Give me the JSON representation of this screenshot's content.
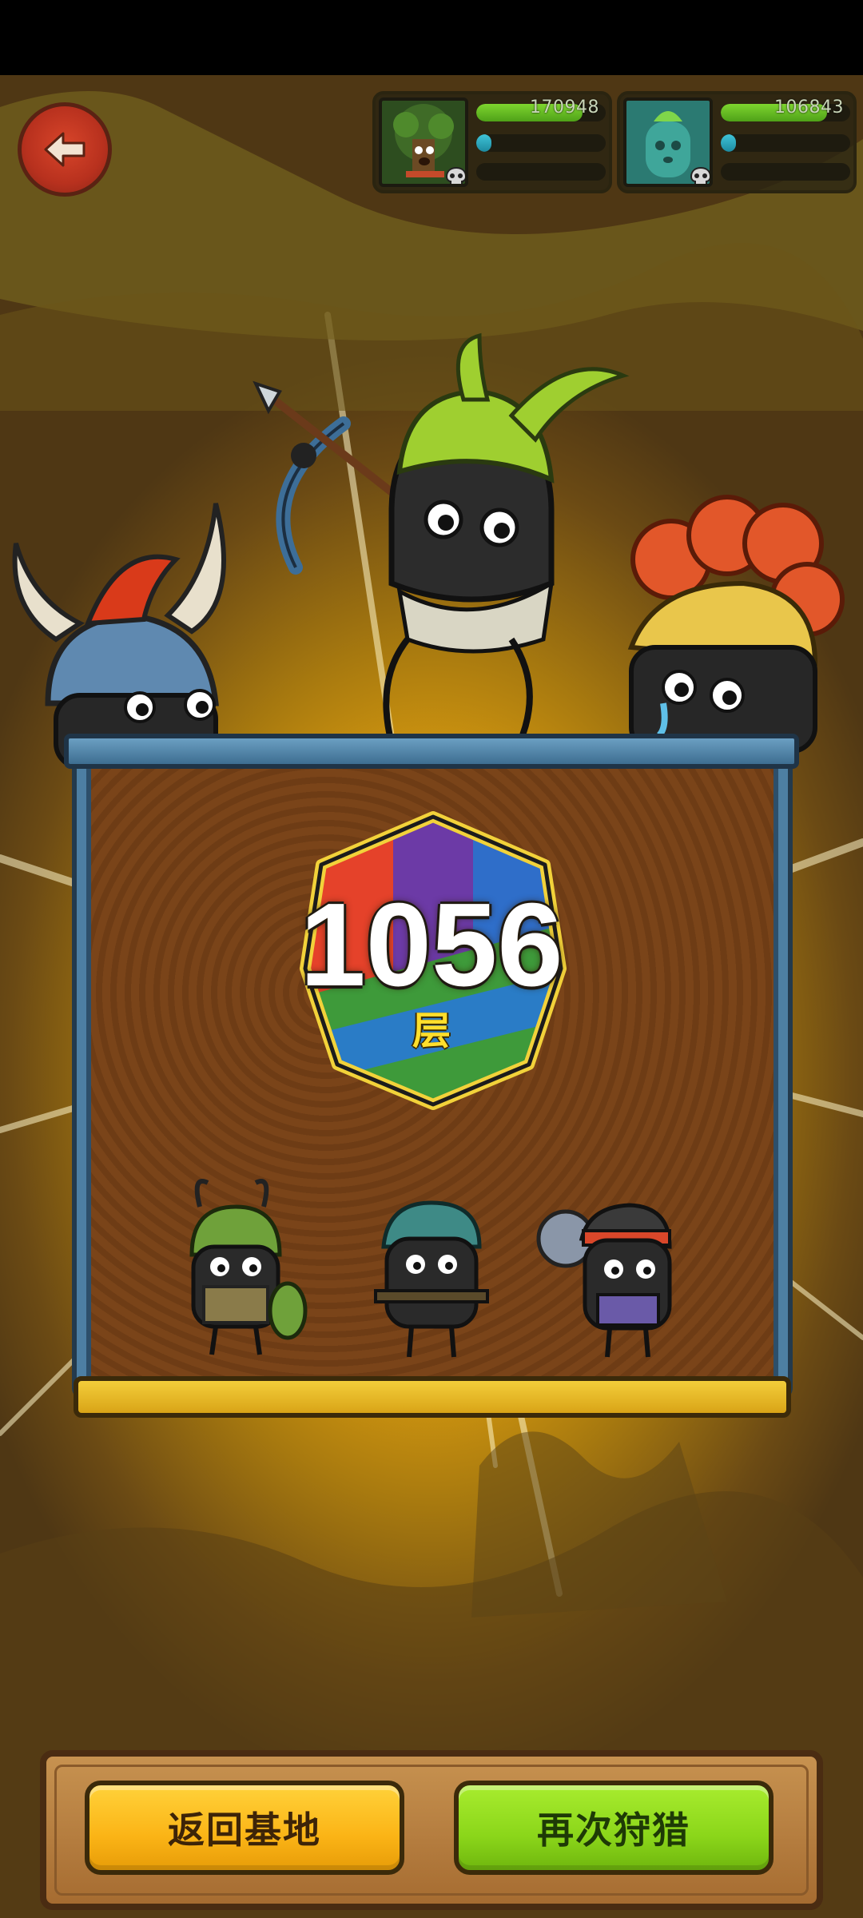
{
  "header": {
    "back_icon": "back-arrow-icon"
  },
  "enemies": [
    {
      "name_icon": "tree-monster-portrait",
      "hp_value": "170948",
      "hp_fraction": 0.82,
      "mp_fraction": 0.12
    },
    {
      "name_icon": "slime-monster-portrait",
      "hp_value": "106843",
      "hp_fraction": 0.82,
      "mp_fraction": 0.12
    }
  ],
  "result": {
    "floor_number": "1056",
    "floor_unit": "层"
  },
  "actions": {
    "return_base_label": "返回基地",
    "hunt_again_label": "再次狩猎"
  },
  "colors": {
    "accent_yellow": "#fbb416",
    "accent_green": "#8bd61a",
    "board_frame": "#4d7fa3"
  }
}
